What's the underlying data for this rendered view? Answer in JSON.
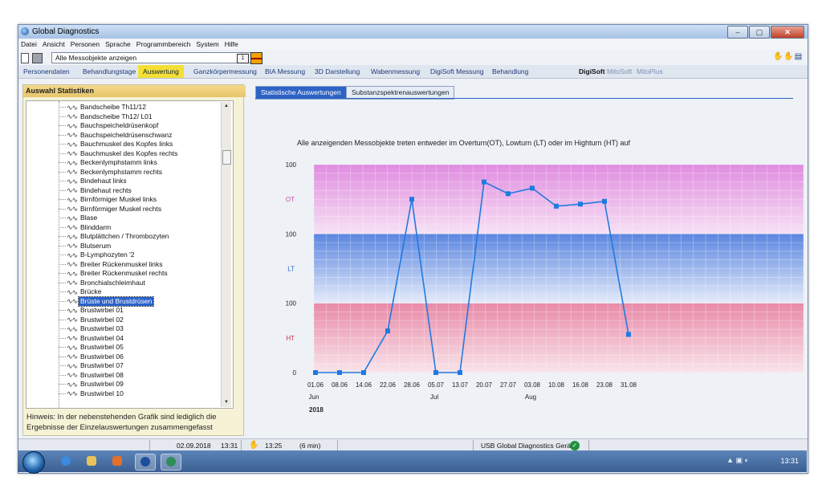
{
  "window": {
    "title": "Global Diagnostics",
    "controls": [
      "–",
      "▢",
      "✕"
    ]
  },
  "menu": [
    "Datei",
    "Ansicht",
    "Personen",
    "Sprache",
    "Programmbereich",
    "System",
    "Hilfe"
  ],
  "toolbar": {
    "combo_value": "Alle Messobjekte anzeigen",
    "icon_label": "1"
  },
  "nav_tabs": [
    "Personendaten",
    "Behandlungstage",
    "Auswertung",
    "Ganzkörpermessung",
    "BIA Messung",
    "3D Darstellung",
    "Wabenmessung",
    "DigiSoft Messung",
    "Behandlung",
    "DigiSoft",
    "MitoSoft",
    "MitoPlus"
  ],
  "left_panel": {
    "title": "Auswahl Statistiken",
    "items": [
      "Bandscheibe Th11/12",
      "Bandscheibe Th12/ L01",
      "Bauchspeicheldrüsenkopf",
      "Bauchspeicheldrüsenschwanz",
      "Bauchmuskel des Kopfes links",
      "Bauchmuskel des Kopfes rechts",
      "Beckenlymphstamm links",
      "Beckenlymphstamm rechts",
      "Bindehaut links",
      "Bindehaut rechts",
      "Birnförmiger Muskel links",
      "Birnförmiger Muskel rechts",
      "Blase",
      "Blinddarm",
      "Blutplättchen / Thrombozyten",
      "Blutserum",
      "B-Lymphozyten '2",
      "Breiter Rückenmuskel links",
      "Breiter Rückenmuskel rechts",
      "Bronchialschleimhaut",
      "Brücke",
      "Brüste und Brustdrüsen",
      "Brustwirbel 01",
      "Brustwirbel 02",
      "Brustwirbel 03",
      "Brustwirbel 04",
      "Brustwirbel 05",
      "Brustwirbel 06",
      "Brustwirbel 07",
      "Brustwirbel 08",
      "Brustwirbel 09",
      "Brustwirbel 10"
    ],
    "selected_index": 21,
    "hint": "Hinweis: In der nebenstehenden Grafik sind lediglich die Ergebnisse der Einzelauswertungen zusammengefasst"
  },
  "content_tabs": [
    "Statistische Auswertungen",
    "Substanzspektrenauswertungen"
  ],
  "chart_data": {
    "type": "line",
    "title": "Alle anzeigenden Messobjekte treten entweder im Overturn(OT), Lowturn (LT) oder im Highturn (HT) auf",
    "y_tick_labels": [
      "100",
      "100",
      "100",
      "0"
    ],
    "zones": [
      {
        "label": "OT",
        "color": "#cc44aa"
      },
      {
        "label": "LT",
        "color": "#3366cc"
      },
      {
        "label": "HT",
        "color": "#cc3355"
      }
    ],
    "x": [
      "01.06",
      "08.06",
      "14.06",
      "22.06",
      "28.06",
      "05.07",
      "13.07",
      "20.07",
      "27.07",
      "03.08",
      "10.08",
      "16.08",
      "23.08",
      "31.08"
    ],
    "month_labels": [
      {
        "label": "Jun",
        "at": "01.06"
      },
      {
        "label": "Jul",
        "at": "05.07"
      },
      {
        "label": "Aug",
        "at": "03.08"
      }
    ],
    "year_label": "2018",
    "y_scale": "0 = bottom, 100 = top of HT, 200 = top of LT, 300 = top of OT",
    "ylim": [
      0,
      300
    ],
    "values": [
      0,
      0,
      0,
      60,
      250,
      0,
      0,
      275,
      258,
      266,
      240,
      243,
      247,
      55
    ],
    "line_color": "#1f7ae0",
    "grid": true
  },
  "status": {
    "date": "02.09.2018",
    "time": "13:31",
    "login_time": "13:25",
    "duration": "(6 min)",
    "device": "USB Global Diagnostics Gerät"
  },
  "taskbar": {
    "clock": "13:31"
  }
}
